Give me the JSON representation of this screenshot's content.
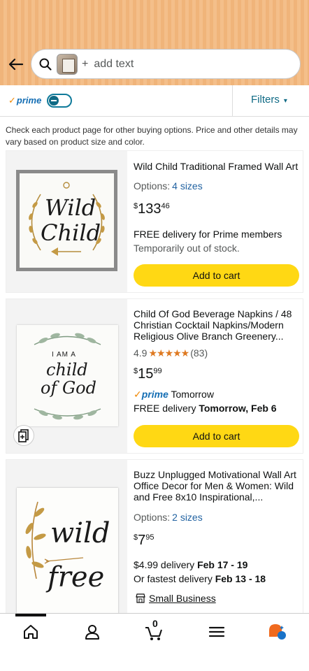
{
  "header": {
    "search_placeholder": "add text",
    "plus": "+"
  },
  "filter_bar": {
    "prime_label": "prime",
    "prime_check": "✓",
    "filters_label": "Filters",
    "filters_chevron": "▾",
    "prime_toggle_on": false
  },
  "notice": "Check each product page for other buying options. Price and other details may vary based on product size and color.",
  "products": [
    {
      "title": "Wild Child Traditional Framed Wall Art",
      "options_label": "Options:",
      "options_value": "4 sizes",
      "price_currency": "$",
      "price_whole": "133",
      "price_fraction": "46",
      "delivery": "FREE delivery for Prime members",
      "stock": "Temporarily out of stock.",
      "button": "Add to cart",
      "art": [
        "Wild",
        "Child"
      ]
    },
    {
      "title": "Child Of God Beverage Napkins / 48 Christian Cocktail Napkins/Modern Religious Olive Branch Greenery...",
      "rating_value": "4.9",
      "stars": "★★★★★",
      "rating_count": "(83)",
      "price_currency": "$",
      "price_whole": "15",
      "price_fraction": "99",
      "prime_check": "✓",
      "prime_label": "prime",
      "prime_delivery": "Tomorrow",
      "delivery_prefix": "FREE delivery ",
      "delivery_date": "Tomorrow, Feb 6",
      "button": "Add to cart",
      "art": [
        "I AM A",
        "child",
        "of God"
      ]
    },
    {
      "title": "Buzz Unplugged Motivational Wall Art Office Decor for Men & Women: Wild and Free 8x10 Inspirational,...",
      "options_label": "Options:",
      "options_value": "2 sizes",
      "price_currency": "$",
      "price_whole": "7",
      "price_fraction": "95",
      "delivery_prefix": "$4.99 delivery ",
      "delivery_date": "Feb 17 - 19",
      "fastest_prefix": "Or fastest delivery ",
      "fastest_date": "Feb 13 - 18",
      "small_business": "Small Business",
      "art": [
        "wild",
        "free"
      ]
    }
  ],
  "bottom_nav": {
    "cart_count": "0",
    "items": [
      "home-icon",
      "account-icon",
      "cart-icon",
      "menu-icon",
      "rufus-icon"
    ]
  },
  "colors": {
    "accent_link": "#2162a1",
    "button_yellow": "#ffd814",
    "prime_blue": "#146eb4",
    "star_orange": "#de7921"
  }
}
